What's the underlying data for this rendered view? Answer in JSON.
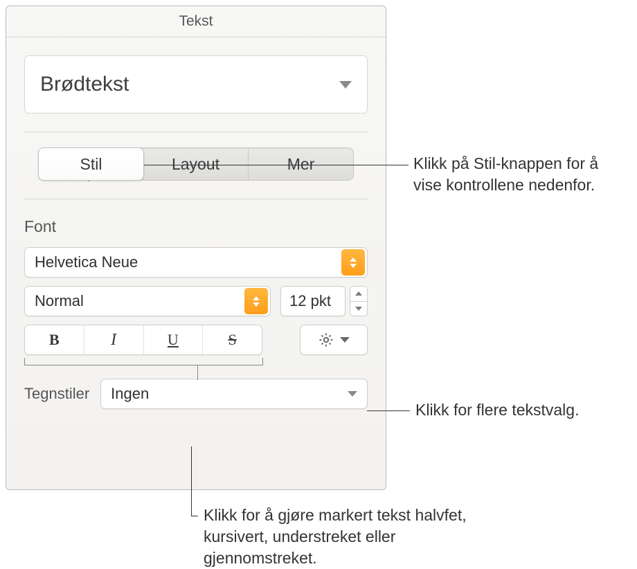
{
  "header": {
    "title": "Tekst"
  },
  "paragraph_style": {
    "value": "Brødtekst"
  },
  "tabs": {
    "stil": "Stil",
    "layout": "Layout",
    "mer": "Mer"
  },
  "font_section": {
    "label": "Font",
    "family": "Helvetica Neue",
    "weight": "Normal",
    "size": "12 pkt"
  },
  "bius": {
    "bold": "B",
    "italic": "I",
    "underline": "U",
    "strike": "S"
  },
  "char_styles": {
    "label": "Tegnstiler",
    "value": "Ingen"
  },
  "callouts": {
    "c1": "Klikk på Stil-knappen for å vise kontrollene nedenfor.",
    "c2": "Klikk for flere tekstvalg.",
    "c3": "Klikk for å gjøre markert tekst halvfet, kursivert, understreket eller gjennomstreket."
  }
}
